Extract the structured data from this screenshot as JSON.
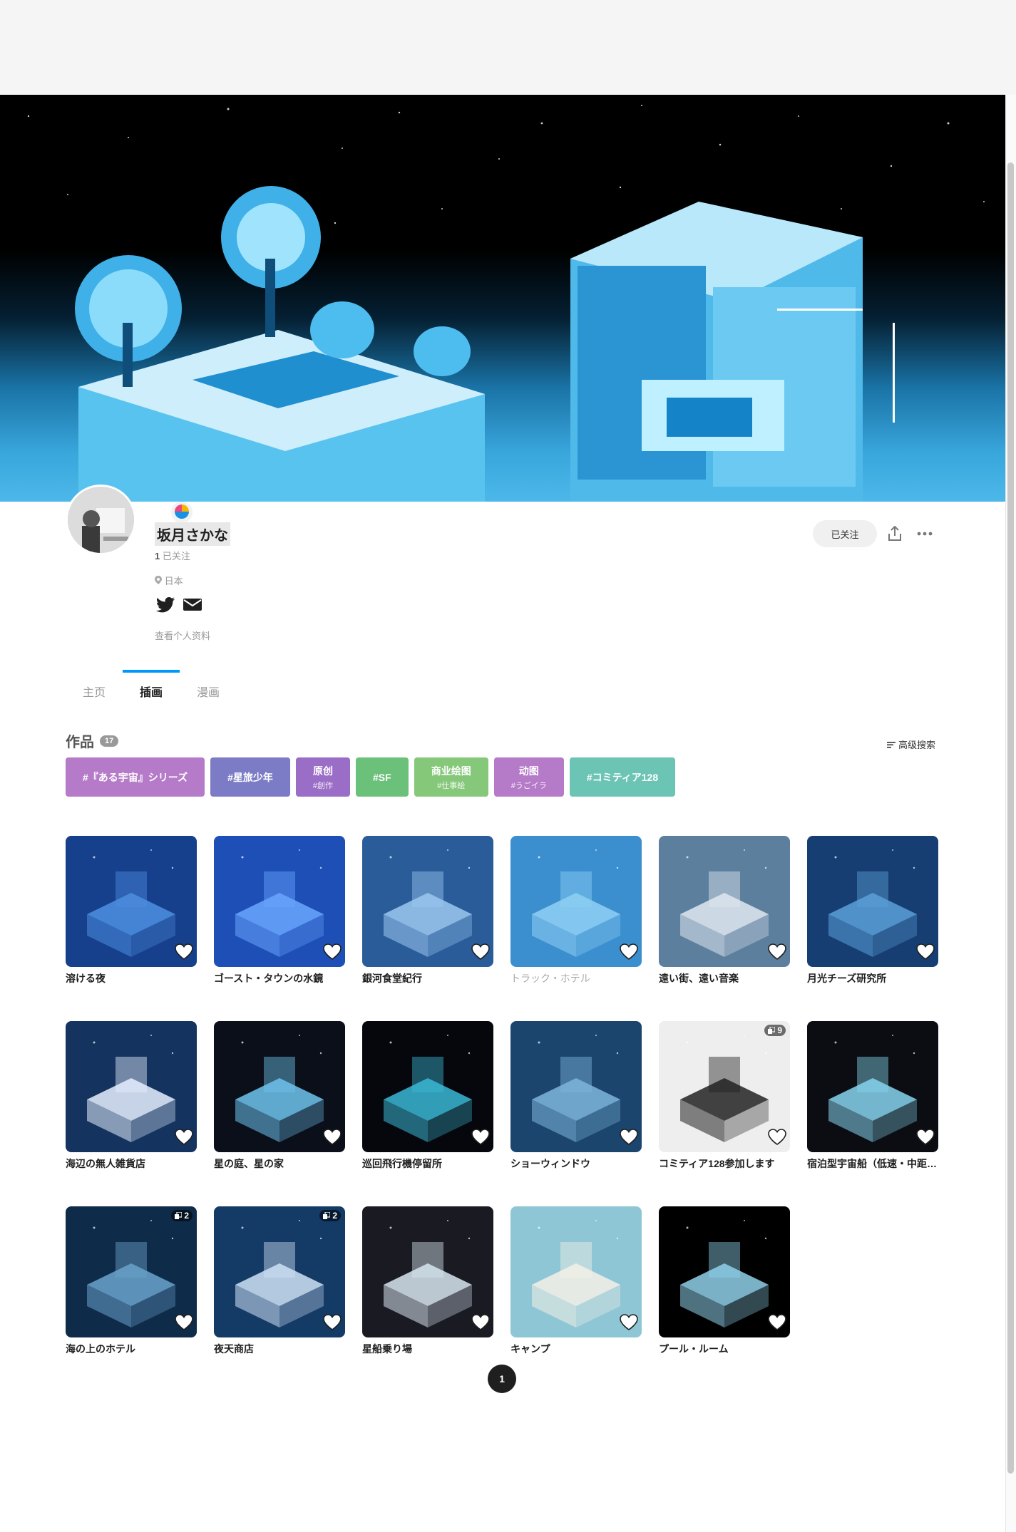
{
  "profile": {
    "name": "坂月さかな",
    "follow_count": "1",
    "follow_label": "已关注",
    "location": "日本",
    "profile_link": "查看个人资料"
  },
  "actions": {
    "follow_button": "已关注",
    "share_icon": "share-icon",
    "more_icon": "more-icon"
  },
  "tabs": [
    {
      "label": "主页",
      "active": false
    },
    {
      "label": "插画",
      "active": true
    },
    {
      "label": "漫画",
      "active": false
    }
  ],
  "works": {
    "title": "作品",
    "count": "17",
    "advanced_search": "高级搜索"
  },
  "tags": [
    {
      "label": "#『ある宇宙』シリーズ",
      "sub": "",
      "color": "#b57bc8"
    },
    {
      "label": "#星旅少年",
      "sub": "",
      "color": "#7c7cc6"
    },
    {
      "label": "原创",
      "sub": "#創作",
      "color": "#9a6dc7"
    },
    {
      "label": "#SF",
      "sub": "",
      "color": "#6cc17a"
    },
    {
      "label": "商业绘图",
      "sub": "#仕事絵",
      "color": "#86c87a"
    },
    {
      "label": "动图",
      "sub": "#うごイラ",
      "color": "#b57bc8"
    },
    {
      "label": "#コミティア128",
      "sub": "",
      "color": "#6cc4b4"
    }
  ],
  "artworks": [
    {
      "title": "溶ける夜",
      "dim": false,
      "pages": "",
      "bg": "#163f8c",
      "accent": "#4d8fe0"
    },
    {
      "title": "ゴースト・タウンの水鏡",
      "dim": false,
      "pages": "",
      "bg": "#1e4fb6",
      "accent": "#6aa6ff"
    },
    {
      "title": "銀河食堂紀行",
      "dim": false,
      "pages": "",
      "bg": "#2a5c9a",
      "accent": "#9cc8f0"
    },
    {
      "title": "トラック・ホテル",
      "dim": true,
      "pages": "",
      "bg": "#3c8fcf",
      "accent": "#8fd0f5"
    },
    {
      "title": "遠い街、遠い音楽",
      "dim": false,
      "pages": "",
      "bg": "#5c7f9e",
      "accent": "#dfe8ef"
    },
    {
      "title": "月光チーズ研究所",
      "dim": false,
      "pages": "",
      "bg": "#173e72",
      "accent": "#5aa0d8"
    },
    {
      "title": "海辺の無人雑貨店",
      "dim": false,
      "pages": "",
      "bg": "#14335e",
      "accent": "#e6f0ff"
    },
    {
      "title": "星の庭、星の家",
      "dim": false,
      "pages": "",
      "bg": "#0a0f1a",
      "accent": "#6ec3ee"
    },
    {
      "title": "巡回飛行機停留所",
      "dim": false,
      "pages": "",
      "bg": "#05070c",
      "accent": "#3bb7d6"
    },
    {
      "title": "ショーウィンドウ",
      "dim": false,
      "pages": "",
      "bg": "#1c456e",
      "accent": "#7fb6dc"
    },
    {
      "title": "コミティア128参加します",
      "dim": false,
      "pages": "9",
      "bg": "#eeeeee",
      "accent": "#222222"
    },
    {
      "title": "宿泊型宇宙船（低速・中距離）",
      "dim": false,
      "pages": "",
      "bg": "#0b0d12",
      "accent": "#86d5ee"
    },
    {
      "title": "海の上のホテル",
      "dim": false,
      "pages": "2",
      "bg": "#0f2b4a",
      "accent": "#6aa3cc"
    },
    {
      "title": "夜天商店",
      "dim": false,
      "pages": "2",
      "bg": "#143a66",
      "accent": "#cfe3f5"
    },
    {
      "title": "星船乗り場",
      "dim": false,
      "pages": "",
      "bg": "#1a1a22",
      "accent": "#d8e6f0"
    },
    {
      "title": "キャンプ",
      "dim": false,
      "pages": "",
      "bg": "#8fc6d6",
      "accent": "#f4f1e6"
    },
    {
      "title": "プール・ルーム",
      "dim": false,
      "pages": "",
      "bg": "#000000",
      "accent": "#8fd0ea"
    }
  ],
  "pagination": {
    "current": "1"
  }
}
